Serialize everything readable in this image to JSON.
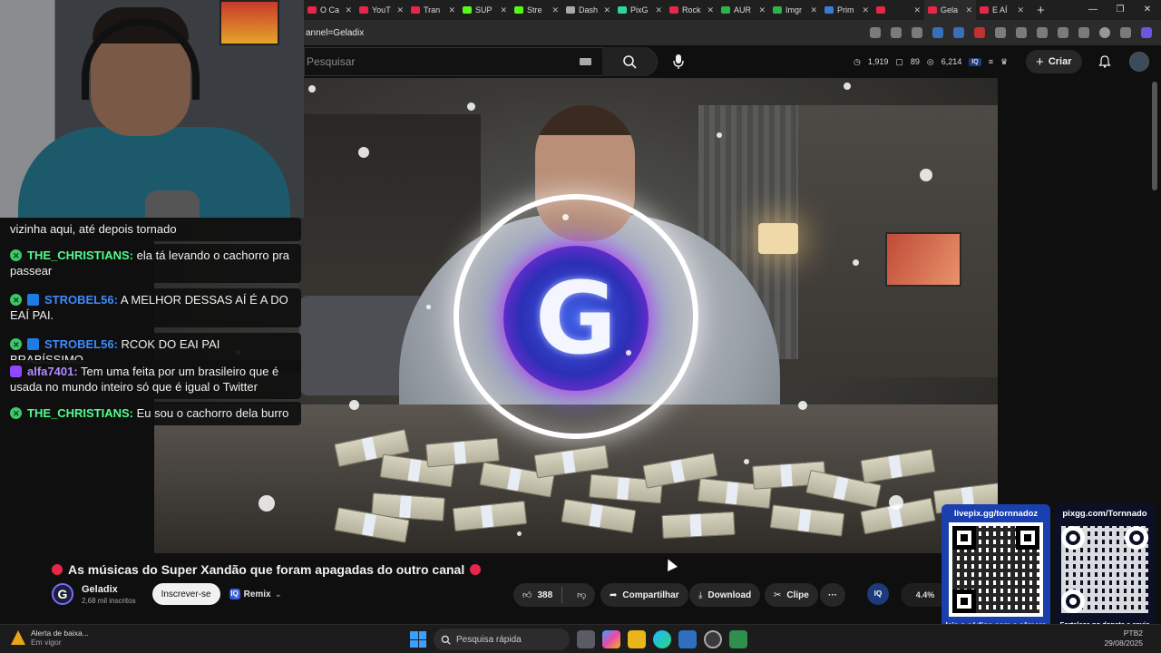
{
  "browser": {
    "tabs": [
      {
        "label": "O Ca",
        "color": "#e8264a"
      },
      {
        "label": "YouT",
        "color": "#e8264a"
      },
      {
        "label": "Tran",
        "color": "#e8264a"
      },
      {
        "label": "SUP",
        "color": "#53fc18"
      },
      {
        "label": "Stre",
        "color": "#53fc18"
      },
      {
        "label": "Dash",
        "color": "#aaaaaa"
      },
      {
        "label": "PixG",
        "color": "#2fd3a0"
      },
      {
        "label": "Rock",
        "color": "#e8264a"
      },
      {
        "label": "AUR",
        "color": "#2fb34a"
      },
      {
        "label": "Imgr",
        "color": "#2fb34a"
      },
      {
        "label": "Prim",
        "color": "#3a7bd5"
      },
      {
        "label": "",
        "color": "#e8264a"
      },
      {
        "label": "Gela",
        "color": "#e8264a"
      },
      {
        "label": "E AÍ",
        "color": "#e8264a"
      }
    ],
    "new_tab": "+",
    "address": "annel=Geladix"
  },
  "masthead": {
    "search_placeholder": "Pesquisar",
    "stat1": "1,919",
    "stat2": "89",
    "stat3": "6,214",
    "create_label": "Criar"
  },
  "chat": {
    "messages": [
      {
        "user": "",
        "text": "vizinha aqui, até depois tornado",
        "badge": "none",
        "color": "#ffffff"
      },
      {
        "user": "THE_CHRISTIANS:",
        "text": "ela tá levando o cachorro pra passear",
        "badge": "green",
        "color": "#53fc8a"
      },
      {
        "user": "STROBEL56:",
        "text": "A MELHOR DESSAS AÍ É A DO EAÍ PAI.",
        "badge": "kick",
        "color": "#3d8bff"
      },
      {
        "user": "STROBEL56:",
        "text": "RCOK DO EAI PAI BRABÍSSIMO.",
        "badge": "kick",
        "color": "#3d8bff"
      },
      {
        "user": "alfa7401:",
        "text": "Tem uma feita por um brasileiro que é usada no mundo inteiro só que é igual o Twitter",
        "badge": "twitch",
        "color": "#b48cff"
      },
      {
        "user": "THE_CHRISTIANS:",
        "text": "Eu sou o cachorro dela burro",
        "badge": "green",
        "color": "#53fc8a"
      }
    ]
  },
  "video": {
    "logo_letter": "G",
    "title": "As músicas do Super Xandão que foram apagadas do outro canal",
    "channel_name": "Geladix",
    "subscribers": "2,68 mil inscritos",
    "subscribe_label": "Inscrever-se",
    "remix_label": "Remix",
    "likes": "388",
    "share_label": "Compartilhar",
    "download_label": "Download",
    "clip_label": "Clipe",
    "more_label": "···",
    "ext_badge": "IQ",
    "ext_percent": "4.4%"
  },
  "qr": {
    "left_title": "livepix.gg/tornnadoz",
    "left_footer": "leia o código com a câmera do celular.",
    "right_title": "pixgg.com/Tornnado",
    "right_footer": "Fortaleça no donate e envie sua mensagem!"
  },
  "taskbar": {
    "weather_title": "Alerta de baixa...",
    "weather_sub": "Em vigor",
    "search_label": "Pesquisa rápida",
    "clock_top": "PTB2",
    "clock_bottom": "29/08/2025"
  }
}
